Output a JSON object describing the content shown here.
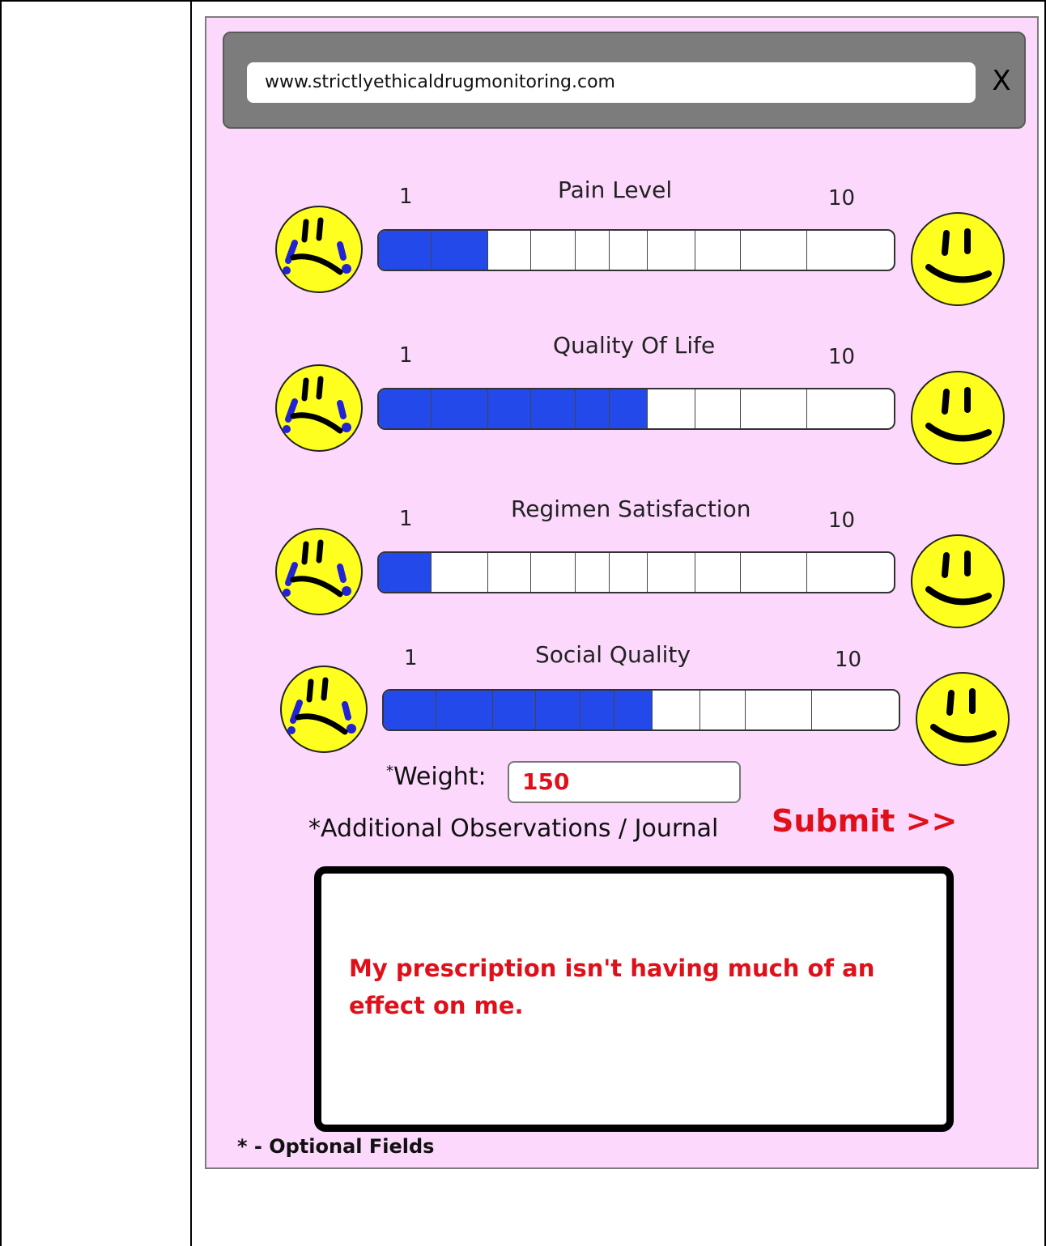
{
  "browser": {
    "url": "www.strictlyethicaldrugmonitoring.com",
    "close_label": "X"
  },
  "sliders": [
    {
      "label": "Pain Level",
      "min_label": "1",
      "max_label": "10",
      "value": 2
    },
    {
      "label": "Quality Of Life",
      "min_label": "1",
      "max_label": "10",
      "value": 6
    },
    {
      "label": "Regimen Satisfaction",
      "min_label": "1",
      "max_label": "10",
      "value": 1
    },
    {
      "label": "Social Quality",
      "min_label": "1",
      "max_label": "10",
      "value": 6
    }
  ],
  "weight": {
    "label": "Weight:",
    "marker": "*",
    "value": "150"
  },
  "observations": {
    "label": "*Additional Observations / Journal",
    "text": "My prescription isn't having much of an effect on me."
  },
  "submit_label": "Submit >>",
  "footnote": "* - Optional Fields",
  "colors": {
    "panel_bg": "#fcd9fc",
    "bar_fill": "#2349ea",
    "accent_red": "#e0101a",
    "face_yellow": "#ffff1f"
  }
}
